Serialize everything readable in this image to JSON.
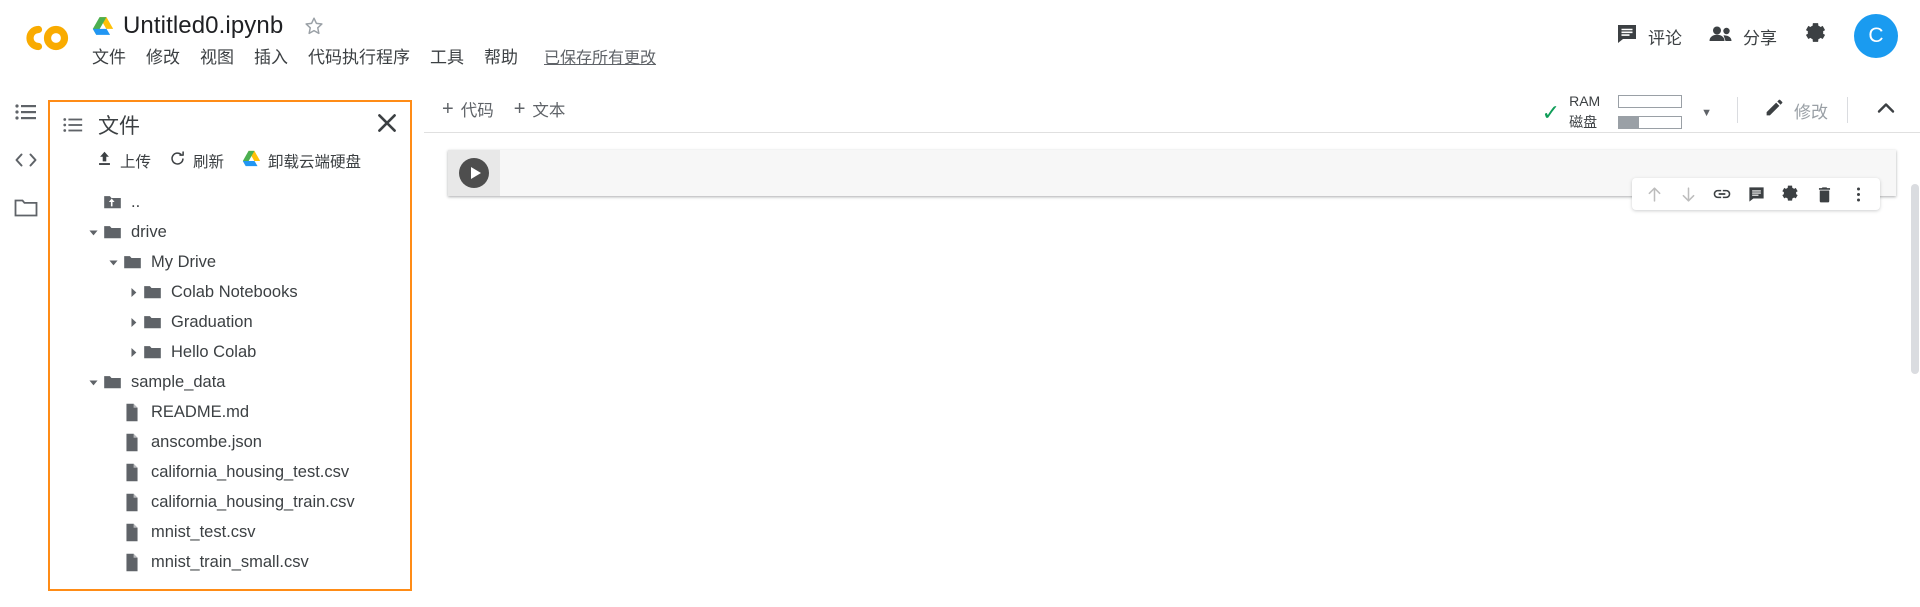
{
  "app": {
    "name": "Google Colab",
    "logo_icon": "colab-logo",
    "accent_orange": "#ff8c16",
    "accent_blue": "#1a9bf0",
    "ok_green": "#0f9d58"
  },
  "titlebar": {
    "drive_icon": "google-drive-icon",
    "document_title": "Untitled0.ipynb",
    "star_icon": "star-outline-icon",
    "menu": [
      {
        "label": "文件",
        "name": "menu-file"
      },
      {
        "label": "修改",
        "name": "menu-edit"
      },
      {
        "label": "视图",
        "name": "menu-view"
      },
      {
        "label": "插入",
        "name": "menu-insert"
      },
      {
        "label": "代码执行程序",
        "name": "menu-runtime"
      },
      {
        "label": "工具",
        "name": "menu-tools"
      },
      {
        "label": "帮助",
        "name": "menu-help"
      }
    ],
    "save_status": "已保存所有更改",
    "comment_label": "评论",
    "comment_icon": "comment-icon",
    "share_label": "分享",
    "share_icon": "people-icon",
    "settings_icon": "gear-icon",
    "avatar_letter": "C"
  },
  "rail": {
    "toc_icon": "table-of-contents-icon",
    "snippets_icon": "code-snippets-icon",
    "files_icon": "folder-icon"
  },
  "files_panel": {
    "list_icon": "list-icon",
    "title": "文件",
    "close_icon": "close-icon",
    "actions": [
      {
        "label": "上传",
        "icon": "upload-icon",
        "name": "upload-button"
      },
      {
        "label": "刷新",
        "icon": "refresh-icon",
        "name": "refresh-button"
      },
      {
        "label": "卸载云端硬盘",
        "icon": "google-drive-icon",
        "name": "unmount-drive-button"
      }
    ],
    "tree": [
      {
        "label": "..",
        "type": "parent",
        "depth": 1,
        "caret": "none",
        "icon": "folder-up-icon"
      },
      {
        "label": "drive",
        "type": "folder",
        "depth": 1,
        "caret": "down",
        "icon": "folder-icon"
      },
      {
        "label": "My Drive",
        "type": "folder",
        "depth": 2,
        "caret": "down",
        "icon": "folder-icon"
      },
      {
        "label": "Colab Notebooks",
        "type": "folder",
        "depth": 3,
        "caret": "right",
        "icon": "folder-icon"
      },
      {
        "label": "Graduation",
        "type": "folder",
        "depth": 3,
        "caret": "right",
        "icon": "folder-icon"
      },
      {
        "label": "Hello Colab",
        "type": "folder",
        "depth": 3,
        "caret": "right",
        "icon": "folder-icon"
      },
      {
        "label": "sample_data",
        "type": "folder",
        "depth": 1,
        "caret": "down",
        "icon": "folder-icon"
      },
      {
        "label": "README.md",
        "type": "file",
        "depth": 2,
        "caret": "none",
        "icon": "file-icon"
      },
      {
        "label": "anscombe.json",
        "type": "file",
        "depth": 2,
        "caret": "none",
        "icon": "file-icon"
      },
      {
        "label": "california_housing_test.csv",
        "type": "file",
        "depth": 2,
        "caret": "none",
        "icon": "file-icon"
      },
      {
        "label": "california_housing_train.csv",
        "type": "file",
        "depth": 2,
        "caret": "none",
        "icon": "file-icon"
      },
      {
        "label": "mnist_test.csv",
        "type": "file",
        "depth": 2,
        "caret": "none",
        "icon": "file-icon"
      },
      {
        "label": "mnist_train_small.csv",
        "type": "file",
        "depth": 2,
        "caret": "none",
        "icon": "file-icon"
      }
    ]
  },
  "notebook_toolbar": {
    "add_code_label": "代码",
    "add_text_label": "文本",
    "add_icon": "plus-icon",
    "connected_icon": "checkmark-icon",
    "ram_label": "RAM",
    "ram_fill_percent": 0,
    "disk_label": "磁盘",
    "disk_fill_percent": 32,
    "resources_caret_icon": "chevron-down-icon",
    "edit_label": "修改",
    "edit_icon": "pencil-icon",
    "collapse_icon": "chevron-up-icon"
  },
  "cell": {
    "run_icon": "play-icon",
    "code_value": "",
    "code_placeholder": "",
    "toolbar": [
      {
        "name": "move-cell-up-button",
        "icon": "arrow-up-icon",
        "dim": true
      },
      {
        "name": "move-cell-down-button",
        "icon": "arrow-down-icon",
        "dim": true
      },
      {
        "name": "link-to-cell-button",
        "icon": "link-icon",
        "dim": false
      },
      {
        "name": "add-comment-button",
        "icon": "comment-icon",
        "dim": false
      },
      {
        "name": "cell-settings-button",
        "icon": "gear-icon",
        "dim": false
      },
      {
        "name": "delete-cell-button",
        "icon": "trash-icon",
        "dim": false
      },
      {
        "name": "more-cell-actions-button",
        "icon": "more-vertical-icon",
        "dim": false
      }
    ]
  }
}
